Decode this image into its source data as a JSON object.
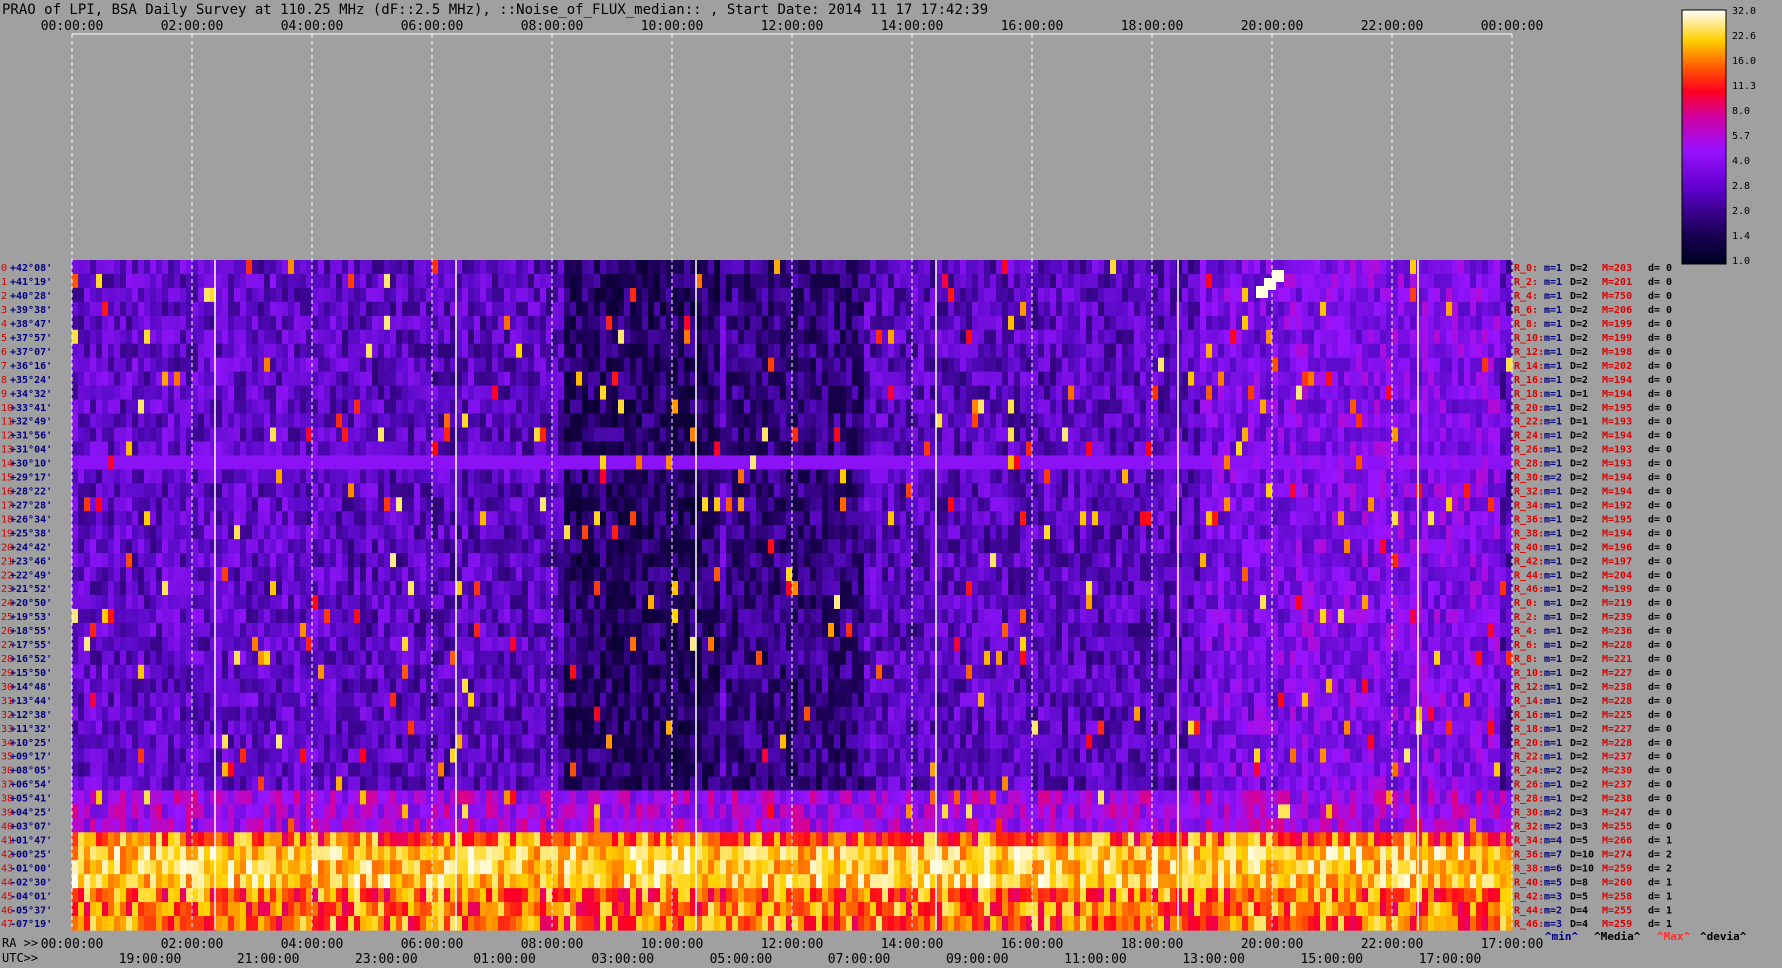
{
  "title": "PRAO of LPI, BSA Daily Survey at 110.25 MHz (dF::2.5 MHz), ::Noise_of_FLUX_median:: , Start Date: 2014 11 17 17:42:39",
  "axis": {
    "ra_prefix": "RA >>",
    "utc_prefix": "UTC>>"
  },
  "legend": {
    "min": "^min^",
    "media": "^Media^",
    "max": "^Max^",
    "devia": "^devia^"
  },
  "chart_data": {
    "type": "heatmap",
    "title": "PRAO of LPI, BSA Daily Survey at 110.25 MHz (dF::2.5 MHz), ::Noise_of_FLUX_median:: , Start Date: 2014 11 17 17:42:39",
    "x_top_ticks": [
      "00:00:00",
      "02:00:00",
      "04:00:00",
      "06:00:00",
      "08:00:00",
      "10:00:00",
      "12:00:00",
      "14:00:00",
      "16:00:00",
      "18:00:00",
      "20:00:00",
      "22:00:00",
      "00:00:00"
    ],
    "x_ra_ticks": [
      "00:00:00",
      "02:00:00",
      "04:00:00",
      "06:00:00",
      "08:00:00",
      "10:00:00",
      "12:00:00",
      "14:00:00",
      "16:00:00",
      "18:00:00",
      "20:00:00",
      "22:00:00",
      "17:00:00"
    ],
    "x_utc_ticks": [
      "19:00:00",
      "21:00:00",
      "23:00:00",
      "01:00:00",
      "03:00:00",
      "05:00:00",
      "07:00:00",
      "09:00:00",
      "11:00:00",
      "13:00:00",
      "15:00:00",
      "17:00:00"
    ],
    "colorbar_ticks": [
      "32.0",
      "22.6",
      "16.0",
      "11.3",
      "8.0",
      "5.7",
      "4.0",
      "2.8",
      "2.0",
      "1.4",
      "1.0"
    ],
    "dec_labels": [
      "+42°08'",
      "+41°19'",
      "+40°28'",
      "+39°38'",
      "+38°47'",
      "+37°57'",
      "+37°07'",
      "+36°16'",
      "+35°24'",
      "+34°32'",
      "+33°41'",
      "+32°49'",
      "+31°56'",
      "+31°04'",
      "+30°10'",
      "+29°17'",
      "+28°22'",
      "+27°28'",
      "+26°34'",
      "+25°38'",
      "+24°42'",
      "+23°46'",
      "+22°49'",
      "+21°52'",
      "+20°50'",
      "+19°53'",
      "+18°55'",
      "+17°55'",
      "+16°52'",
      "+15°50'",
      "+14°48'",
      "+13°44'",
      "+12°38'",
      "+11°32'",
      "+10°25'",
      "+09°17'",
      "+08°05'",
      "+06°54'",
      "+05°41'",
      "+04°25'",
      "+03°07'",
      "+01°47'",
      "+00°25'",
      "-01°00'",
      "-02°30'",
      "-04°01'",
      "-05°37'",
      "-07°19'"
    ],
    "row_stats": [
      {
        "r": "R_0:",
        "m": "m=1",
        "d": "D=2",
        "M": "M=203",
        "dv": "d= 0"
      },
      {
        "r": "R_2:",
        "m": "m=1",
        "d": "D=2",
        "M": "M=201",
        "dv": "d= 0"
      },
      {
        "r": "R_4:",
        "m": "m=1",
        "d": "D=2",
        "M": "M=750",
        "dv": "d= 0"
      },
      {
        "r": "R_6:",
        "m": "m=1",
        "d": "D=2",
        "M": "M=206",
        "dv": "d= 0"
      },
      {
        "r": "R_8:",
        "m": "m=1",
        "d": "D=2",
        "M": "M=199",
        "dv": "d= 0"
      },
      {
        "r": "R_10:",
        "m": "m=1",
        "d": "D=2",
        "M": "M=199",
        "dv": "d= 0"
      },
      {
        "r": "R_12:",
        "m": "m=1",
        "d": "D=2",
        "M": "M=198",
        "dv": "d= 0"
      },
      {
        "r": "R_14:",
        "m": "m=1",
        "d": "D=2",
        "M": "M=202",
        "dv": "d= 0"
      },
      {
        "r": "R_16:",
        "m": "m=1",
        "d": "D=2",
        "M": "M=194",
        "dv": "d= 0"
      },
      {
        "r": "R_18:",
        "m": "m=1",
        "d": "D=1",
        "M": "M=194",
        "dv": "d= 0"
      },
      {
        "r": "R_20:",
        "m": "m=1",
        "d": "D=2",
        "M": "M=195",
        "dv": "d= 0"
      },
      {
        "r": "R_22:",
        "m": "m=1",
        "d": "D=1",
        "M": "M=193",
        "dv": "d= 0"
      },
      {
        "r": "R_24:",
        "m": "m=1",
        "d": "D=2",
        "M": "M=194",
        "dv": "d= 0"
      },
      {
        "r": "R_26:",
        "m": "m=1",
        "d": "D=2",
        "M": "M=193",
        "dv": "d= 0"
      },
      {
        "r": "R_28:",
        "m": "m=1",
        "d": "D=2",
        "M": "M=193",
        "dv": "d= 0"
      },
      {
        "r": "R_30:",
        "m": "m=2",
        "d": "D=2",
        "M": "M=194",
        "dv": "d= 0"
      },
      {
        "r": "R_32:",
        "m": "m=1",
        "d": "D=2",
        "M": "M=194",
        "dv": "d= 0"
      },
      {
        "r": "R_34:",
        "m": "m=1",
        "d": "D=2",
        "M": "M=192",
        "dv": "d= 0"
      },
      {
        "r": "R_36:",
        "m": "m=1",
        "d": "D=2",
        "M": "M=195",
        "dv": "d= 0"
      },
      {
        "r": "R_38:",
        "m": "m=1",
        "d": "D=2",
        "M": "M=194",
        "dv": "d= 0"
      },
      {
        "r": "R_40:",
        "m": "m=1",
        "d": "D=2",
        "M": "M=196",
        "dv": "d= 0"
      },
      {
        "r": "R_42:",
        "m": "m=1",
        "d": "D=2",
        "M": "M=197",
        "dv": "d= 0"
      },
      {
        "r": "R_44:",
        "m": "m=1",
        "d": "D=2",
        "M": "M=204",
        "dv": "d= 0"
      },
      {
        "r": "R_46:",
        "m": "m=1",
        "d": "D=2",
        "M": "M=199",
        "dv": "d= 0"
      },
      {
        "r": "R_0:",
        "m": "m=1",
        "d": "D=2",
        "M": "M=219",
        "dv": "d= 0"
      },
      {
        "r": "R_2:",
        "m": "m=1",
        "d": "D=2",
        "M": "M=239",
        "dv": "d= 0"
      },
      {
        "r": "R_4:",
        "m": "m=1",
        "d": "D=2",
        "M": "M=236",
        "dv": "d= 0"
      },
      {
        "r": "R_6:",
        "m": "m=1",
        "d": "D=2",
        "M": "M=228",
        "dv": "d= 0"
      },
      {
        "r": "R_8:",
        "m": "m=1",
        "d": "D=2",
        "M": "M=221",
        "dv": "d= 0"
      },
      {
        "r": "R_10:",
        "m": "m=1",
        "d": "D=2",
        "M": "M=227",
        "dv": "d= 0"
      },
      {
        "r": "R_12:",
        "m": "m=1",
        "d": "D=2",
        "M": "M=238",
        "dv": "d= 0"
      },
      {
        "r": "R_14:",
        "m": "m=1",
        "d": "D=2",
        "M": "M=228",
        "dv": "d= 0"
      },
      {
        "r": "R_16:",
        "m": "m=1",
        "d": "D=2",
        "M": "M=225",
        "dv": "d= 0"
      },
      {
        "r": "R_18:",
        "m": "m=1",
        "d": "D=2",
        "M": "M=227",
        "dv": "d= 0"
      },
      {
        "r": "R_20:",
        "m": "m=1",
        "d": "D=2",
        "M": "M=228",
        "dv": "d= 0"
      },
      {
        "r": "R_22:",
        "m": "m=1",
        "d": "D=2",
        "M": "M=237",
        "dv": "d= 0"
      },
      {
        "r": "R_24:",
        "m": "m=2",
        "d": "D=2",
        "M": "M=230",
        "dv": "d= 0"
      },
      {
        "r": "R_26:",
        "m": "m=1",
        "d": "D=2",
        "M": "M=237",
        "dv": "d= 0"
      },
      {
        "r": "R_28:",
        "m": "m=1",
        "d": "D=2",
        "M": "M=238",
        "dv": "d= 0"
      },
      {
        "r": "R_30:",
        "m": "m=2",
        "d": "D=3",
        "M": "M=247",
        "dv": "d= 0"
      },
      {
        "r": "R_32:",
        "m": "m=2",
        "d": "D=3",
        "M": "M=255",
        "dv": "d= 0"
      },
      {
        "r": "R_34:",
        "m": "m=4",
        "d": "D=5",
        "M": "M=266",
        "dv": "d= 1"
      },
      {
        "r": "R_36:",
        "m": "m=7",
        "d": "D=10",
        "M": "M=274",
        "dv": "d= 2"
      },
      {
        "r": "R_38:",
        "m": "m=6",
        "d": "D=10",
        "M": "M=259",
        "dv": "d= 2"
      },
      {
        "r": "R_40:",
        "m": "m=5",
        "d": "D=8",
        "M": "M=260",
        "dv": "d= 1"
      },
      {
        "r": "R_42:",
        "m": "m=3",
        "d": "D=5",
        "M": "M=258",
        "dv": "d= 1"
      },
      {
        "r": "R_44:",
        "m": "m=2",
        "d": "D=4",
        "M": "M=255",
        "dv": "d= 1"
      },
      {
        "r": "R_46:",
        "m": "m=3",
        "d": "D=4",
        "M": "M=259",
        "dv": "d= 1"
      }
    ],
    "bright_bands_dec": [
      "+01°47'",
      "+00°25'",
      "-01°00'",
      "-02°30'",
      "-04°01'",
      "-05°37'",
      "-07°19'"
    ],
    "colors": {
      "background": "#a0a0a0",
      "low": "#000033",
      "mid": "#8000ff",
      "high": "#ff0000",
      "peak": "#ffffff",
      "label_red": "#dd0000",
      "label_blue": "#000080"
    }
  }
}
